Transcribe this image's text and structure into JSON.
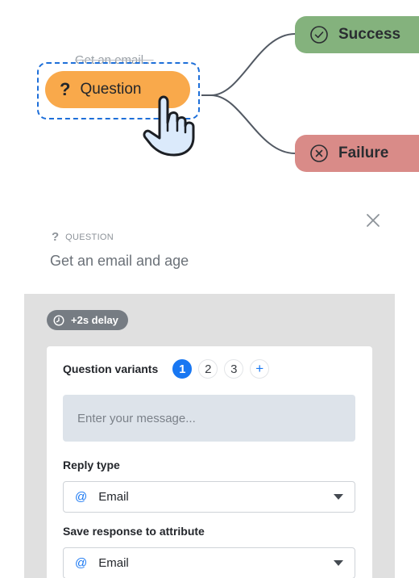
{
  "flow": {
    "hint_text": "Get an email...",
    "question_icon": "?",
    "question_label": "Question",
    "success_label": "Success",
    "failure_label": "Failure"
  },
  "panel": {
    "breadcrumb_icon": "?",
    "breadcrumb_type": "QUESTION",
    "title": "Get an email and age",
    "delay_badge": "+2s delay"
  },
  "variants": {
    "label": "Question variants",
    "items": [
      "1",
      "2",
      "3"
    ],
    "active_index": 0,
    "add_label": "+"
  },
  "message": {
    "placeholder": "Enter your message..."
  },
  "reply_type": {
    "label": "Reply type",
    "prefix": "@",
    "value": "Email"
  },
  "save_response": {
    "label": "Save response to attribute",
    "prefix": "@",
    "value": "Email"
  },
  "colors": {
    "question_node": "#f9a94b",
    "success_node": "#84b27d",
    "failure_node": "#d98b88",
    "accent": "#1877f2",
    "section_bg": "#e0e0e0"
  },
  "icons": [
    "check-circle-icon",
    "x-circle-icon",
    "pointing-hand-icon",
    "close-icon",
    "clock-icon",
    "chevron-down-icon"
  ]
}
